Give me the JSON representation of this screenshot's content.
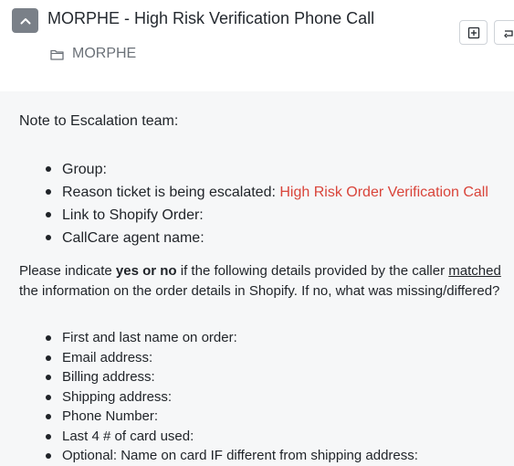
{
  "header": {
    "title": "MORPHE - High Risk Verification Phone Call",
    "folder": "MORPHE"
  },
  "body": {
    "note": "Note to Escalation team:",
    "escalation_items": [
      {
        "label": "Group:"
      },
      {
        "label": "Reason ticket is being escalated: ",
        "value": "High Risk Order Verification Call"
      },
      {
        "label": "Link to Shopify Order:"
      },
      {
        "label": "CallCare agent name:"
      }
    ],
    "instructions": {
      "part1": "Please indicate ",
      "bold": "yes or no",
      "part2": " if the following details provided by the caller ",
      "underlined": "matched",
      "part3": " the information on the order details in Shopify. If no, what was missing/differed?"
    },
    "detail_items": [
      "First and last name on order:",
      "Email address:",
      "Billing address:",
      "Shipping address:",
      "Phone Number:",
      "Last 4 # of card used:",
      "Optional: Name on card IF different from shipping address:"
    ]
  },
  "colors": {
    "highlight": "#d9443a",
    "collapse_button": "#7a8088",
    "content_background": "#f6f7f8"
  },
  "icons": [
    "chevron-up-icon",
    "folder-icon",
    "add-square-icon",
    "reply-icon"
  ]
}
